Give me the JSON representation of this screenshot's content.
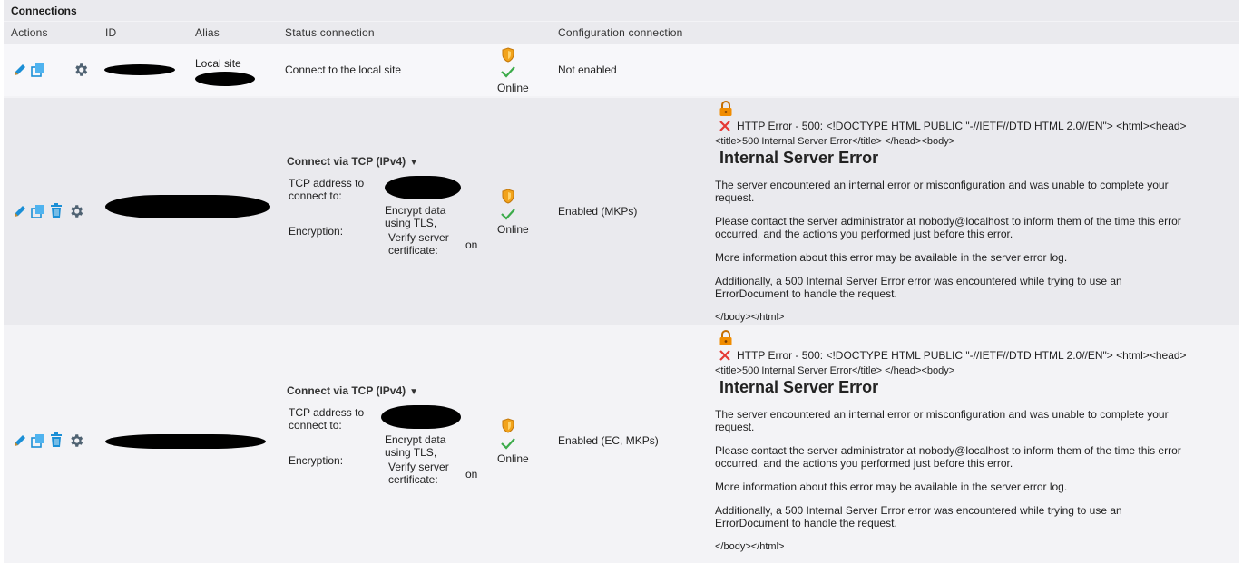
{
  "panel": {
    "title": "Connections"
  },
  "columns": [
    "Actions",
    "ID",
    "Alias",
    "Status connection",
    "Configuration connection"
  ],
  "rows": [
    {
      "alias": "Local site",
      "status_text": "Connect to the local site",
      "online": "Online",
      "config": "Not enabled"
    },
    {
      "connect_mode": "Connect via TCP (IPv4)",
      "tcp_label_1": "TCP address to",
      "tcp_label_2": "connect to:",
      "enc_label": "Encryption:",
      "enc_value_1": "Encrypt data",
      "enc_value_2": "using TLS,",
      "verify_1": "Verify server",
      "verify_2": "certificate:",
      "verify_value": "on",
      "online": "Online",
      "config": "Enabled (MKPs)",
      "error": {
        "line1": "HTTP Error - 500: <!DOCTYPE HTML PUBLIC \"-//IETF//DTD HTML 2.0//EN\"> <html><head>",
        "line2": "<title>500 Internal Server Error</title> </head><body>",
        "heading": "Internal Server Error",
        "p1a": "The server encountered an internal error or misconfiguration and was unable to complete your",
        "p1b": "request.",
        "p2a": "Please contact the server administrator at nobody@localhost to inform them of the time this error",
        "p2b": "occurred, and the actions you performed just before this error.",
        "p3": "More information about this error may be available in the server error log.",
        "p4a": "Additionally, a 500 Internal Server Error error was encountered while trying to use an",
        "p4b": "ErrorDocument to handle the request.",
        "end": "</body></html>"
      }
    },
    {
      "connect_mode": "Connect via TCP (IPv4)",
      "tcp_label_1": "TCP address to",
      "tcp_label_2": "connect to:",
      "enc_label": "Encryption:",
      "enc_value_1": "Encrypt data",
      "enc_value_2": "using TLS,",
      "verify_1": "Verify server",
      "verify_2": "certificate:",
      "verify_value": "on",
      "online": "Online",
      "config": "Enabled (EC, MKPs)",
      "error": {
        "line1": "HTTP Error - 500: <!DOCTYPE HTML PUBLIC \"-//IETF//DTD HTML 2.0//EN\"> <html><head>",
        "line2": "<title>500 Internal Server Error</title> </head><body>",
        "heading": "Internal Server Error",
        "p1a": "The server encountered an internal error or misconfiguration and was unable to complete your",
        "p1b": "request.",
        "p2a": "Please contact the server administrator at nobody@localhost to inform them of the time this error",
        "p2b": "occurred, and the actions you performed just before this error.",
        "p3": "More information about this error may be available in the server error log.",
        "p4a": "Additionally, a 500 Internal Server Error error was encountered while trying to use an",
        "p4b": "ErrorDocument to handle the request.",
        "end": "</body></html>"
      }
    }
  ],
  "icons": {
    "edit": "pencil-icon",
    "clone": "clone-icon",
    "delete": "trash-icon",
    "settings": "gear-icon",
    "shield": "shield-icon",
    "check": "checkmark-icon",
    "lock": "lock-icon",
    "error": "error-x-icon",
    "dropdown": "caret-down-icon"
  },
  "colors": {
    "accent_blue": "#1b8fd6",
    "gear_gray": "#4f6272",
    "shield_orange": "#f2a31b",
    "check_green": "#3cab4a",
    "error_red": "#e53935",
    "lock_orange": "#f08c00"
  }
}
